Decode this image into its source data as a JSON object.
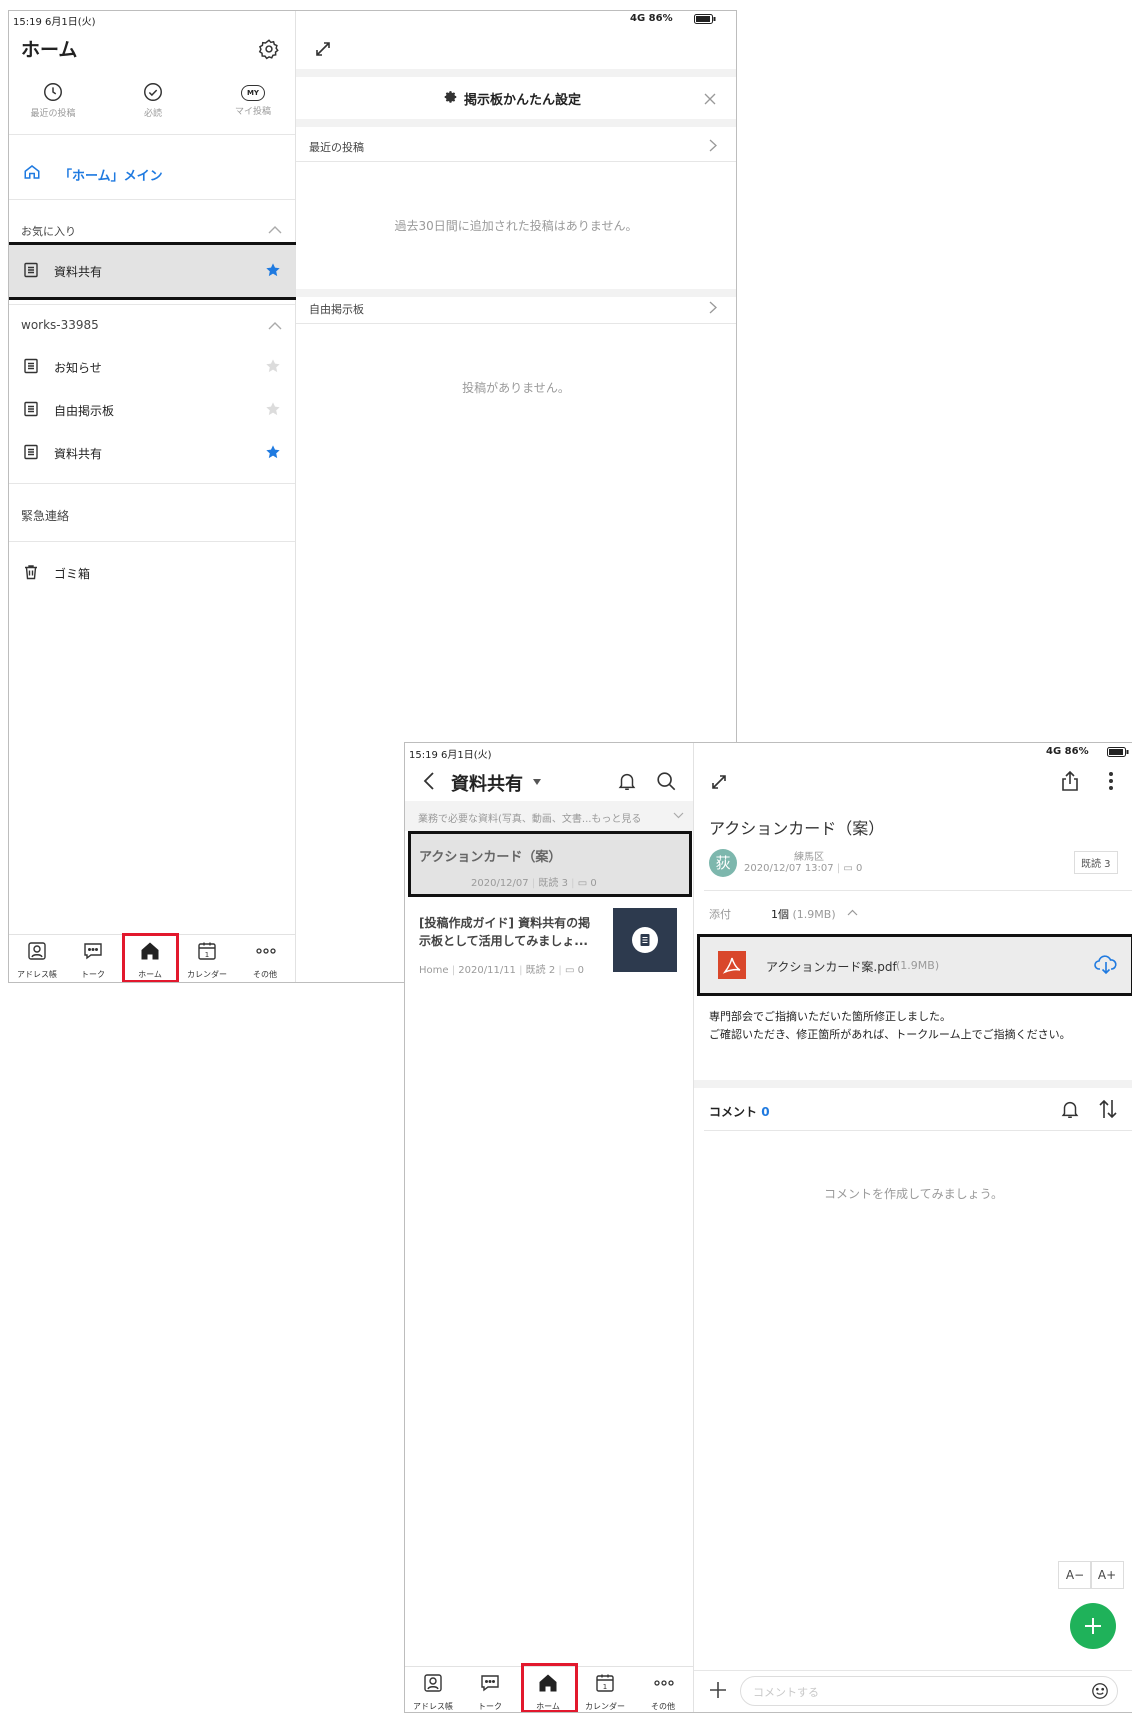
{
  "screen1": {
    "status": {
      "time": "15:19  6月1日(火)",
      "signal": "4G 86%"
    },
    "left": {
      "title": "ホーム",
      "top_tabs": [
        {
          "label": "最近の投稿",
          "icon": "clock-icon"
        },
        {
          "label": "必読",
          "icon": "check-circle-icon"
        },
        {
          "label": "マイ投稿",
          "icon": "my-icon"
        }
      ],
      "my_badge": "MY",
      "home_main": "「ホーム」メイン",
      "favorites_header": "お気に入り",
      "favorites": [
        {
          "label": "資料共有",
          "starred": true
        }
      ],
      "group_header": "works-33985",
      "boards": [
        {
          "label": "お知らせ",
          "starred": false
        },
        {
          "label": "自由掲示板",
          "starred": false
        },
        {
          "label": "資料共有",
          "starred": true
        }
      ],
      "emergency": "緊急連絡",
      "trash": "ゴミ箱"
    },
    "right": {
      "settings_title": "掲示板かんたん設定",
      "recent_header": "最近の投稿",
      "recent_empty": "過去30日間に追加された投稿はありません。",
      "free_header": "自由掲示板",
      "free_empty": "投稿がありません。"
    },
    "bottom_tabs": [
      {
        "label": "アドレス帳",
        "icon": "address-book-icon"
      },
      {
        "label": "トーク",
        "icon": "talk-icon"
      },
      {
        "label": "ホーム",
        "icon": "home-icon",
        "active": true
      },
      {
        "label": "カレンダー",
        "icon": "calendar-icon"
      },
      {
        "label": "その他",
        "icon": "more-icon"
      }
    ]
  },
  "screen2": {
    "status": {
      "time": "15:19  6月1日(火)",
      "signal": "4G 86%"
    },
    "left": {
      "title": "資料共有",
      "description": "業務で必要な資料(写真、動画、文書...もっと見る",
      "posts": [
        {
          "title": "アクションカード（案）",
          "meta_date": "2020/12/07",
          "meta_read": "既読 3",
          "meta_comments": "0"
        },
        {
          "title": "[投稿作成ガイド] 資料共有の掲示板として活用してみましょ...",
          "meta_src": "Home",
          "meta_date": "2020/11/11",
          "meta_read": "既読 2",
          "meta_comments": "0"
        }
      ]
    },
    "right": {
      "title": "アクションカード（案）",
      "avatar_char": "荻",
      "author": "練馬区",
      "datetime": "2020/12/07 13:07",
      "comment_count": "0",
      "read_badge": "既読 3",
      "attach_label": "添付",
      "attach_count": "1個",
      "attach_size": "(1.9MB)",
      "file_name": "アクションカード案.pdf",
      "file_size": "(1.9MB)",
      "body_line1": "専門部会でご指摘いただいた箇所修正しました。",
      "body_line2": "ご確認いただき、修正箇所があれば、トークルーム上でご指摘ください。",
      "comments_label": "コメント",
      "comments_count": "0",
      "comments_empty": "コメントを作成してみましょう。",
      "font_smaller": "A−",
      "font_larger": "A+",
      "comment_placeholder": "コメントする"
    },
    "bottom_tabs": [
      {
        "label": "アドレス帳",
        "icon": "address-book-icon"
      },
      {
        "label": "トーク",
        "icon": "talk-icon"
      },
      {
        "label": "ホーム",
        "icon": "home-icon",
        "active": true
      },
      {
        "label": "カレンダー",
        "icon": "calendar-icon"
      },
      {
        "label": "その他",
        "icon": "more-icon"
      }
    ]
  },
  "colors": {
    "accent_blue": "#1f7ae0",
    "highlight_red": "#e2182d",
    "fab_green": "#1fb25a",
    "pdf_red": "#d9472b",
    "selected_gray": "#e3e3e3"
  }
}
